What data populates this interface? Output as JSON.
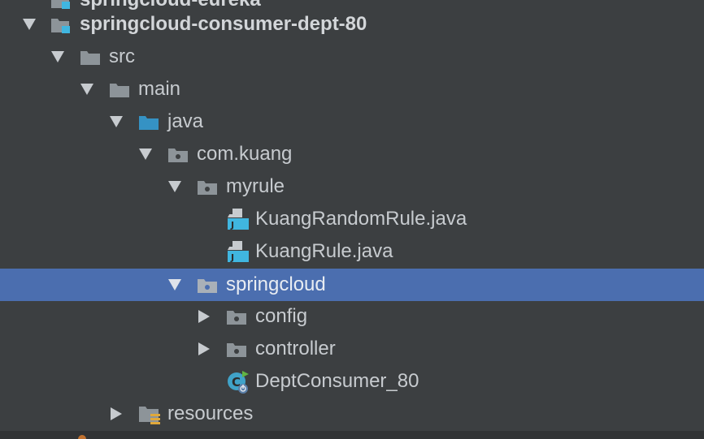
{
  "colors": {
    "background": "#3c3f41",
    "selection": "#4b6eaf",
    "text": "#c7cbcf",
    "folder_grey": "#8d9499",
    "folder_blue": "#3592c4",
    "module_blue": "#40b6e0",
    "resource_yellow": "#e0a83a",
    "spring_green": "#62b543"
  },
  "tree": {
    "partial_top_text": "springcloud-eureka",
    "module": {
      "label": "springcloud-consumer-dept-80",
      "icon": "module-folder-icon",
      "expanded": true
    },
    "src": {
      "label": "src",
      "icon": "folder-icon",
      "expanded": true
    },
    "main": {
      "label": "main",
      "icon": "folder-icon",
      "expanded": true
    },
    "java": {
      "label": "java",
      "icon": "source-root-folder-icon",
      "expanded": true
    },
    "com_kuang": {
      "label": "com.kuang",
      "icon": "package-icon",
      "expanded": true
    },
    "myrule": {
      "label": "myrule",
      "icon": "package-icon",
      "expanded": true
    },
    "kuang_random_rule": {
      "label": "KuangRandomRule.java",
      "icon": "java-file-icon"
    },
    "kuang_rule": {
      "label": "KuangRule.java",
      "icon": "java-file-icon"
    },
    "springcloud": {
      "label": "springcloud",
      "icon": "package-icon",
      "expanded": true,
      "selected": true
    },
    "config": {
      "label": "config",
      "icon": "package-icon",
      "expanded": false
    },
    "controller": {
      "label": "controller",
      "icon": "package-icon",
      "expanded": false
    },
    "dept_consumer": {
      "label": "DeptConsumer_80",
      "icon": "spring-boot-class-icon"
    },
    "resources": {
      "label": "resources",
      "icon": "resources-folder-icon",
      "expanded": false
    }
  }
}
